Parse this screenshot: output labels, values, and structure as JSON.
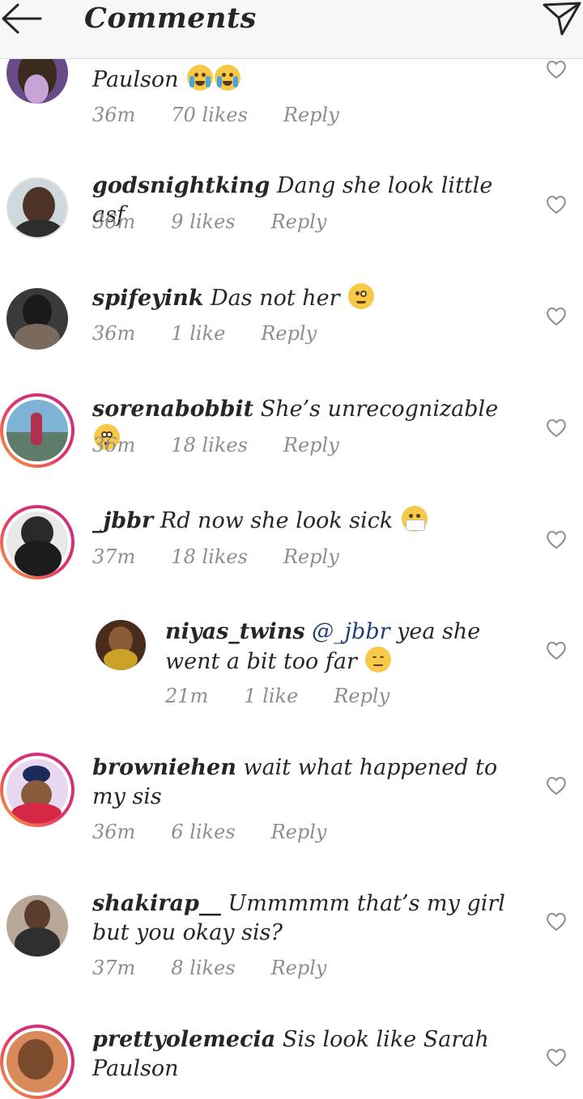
{
  "header": {
    "title": "Comments",
    "back_icon": "arrow-left-icon",
    "send_icon": "paper-plane-icon"
  },
  "colors": {
    "ring_start": "#f9a33b",
    "ring_end": "#c13584",
    "meta_gray": "#8e8e8e",
    "mention_blue": "#1f3d7a"
  },
  "comments": [
    {
      "username": "",
      "text": "Paulson",
      "emoji": "crying-face-icon",
      "time": "36m",
      "likes": "70 likes",
      "reply": "Reply"
    },
    {
      "username": "godsnightking",
      "text": "Dang she look little asf",
      "time": "36m",
      "likes": "9 likes",
      "reply": "Reply"
    },
    {
      "username": "spifeyink",
      "text": "Das not her",
      "emoji": "monocle-face-icon",
      "time": "36m",
      "likes": "1 like",
      "reply": "Reply"
    },
    {
      "username": "sorenabobbit",
      "text": "She’s unrecognizable",
      "emoji": "flushed-face-icon",
      "time": "36m",
      "likes": "18 likes",
      "reply": "Reply"
    },
    {
      "username": "_jbbr",
      "text": "Rd now she look sick",
      "emoji": "mask-face-icon",
      "time": "37m",
      "likes": "18 likes",
      "reply": "Reply"
    },
    {
      "username": "niyas_twins",
      "mention": "@_jbbr",
      "text": "yea she went a bit too far",
      "emoji": "pensive-face-icon",
      "time": "21m",
      "likes": "1 like",
      "reply": "Reply"
    },
    {
      "username": "browniehen",
      "text": "wait what happened to my sis",
      "time": "36m",
      "likes": "6 likes",
      "reply": "Reply"
    },
    {
      "username": "shakirap__",
      "text": "Ummmmm that’s my girl but you okay sis?",
      "time": "37m",
      "likes": "8 likes",
      "reply": "Reply"
    },
    {
      "username": "prettyolemecia",
      "text": "Sis look like Sarah Paulson",
      "time": "",
      "likes": "",
      "reply": ""
    }
  ]
}
